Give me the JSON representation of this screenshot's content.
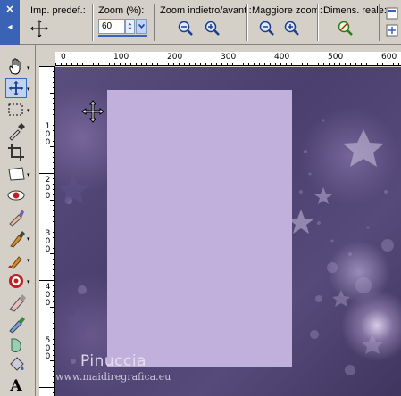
{
  "toolbar": {
    "presets_label": "Imp. predef.:",
    "zoom_label": "Zoom (%):",
    "zoom_value": "60",
    "zoom_inout_label": "Zoom indietro/avanti:",
    "zoom_more_label": "Maggiore zoom:",
    "actual_size_label": "Dimens. reale:"
  },
  "ruler_top": [
    "0",
    "100",
    "200",
    "300",
    "400",
    "500",
    "600"
  ],
  "ruler_left": [
    "1 0 0",
    "2 0 0",
    "3 0 0",
    "4 0 0",
    "5 0 0"
  ],
  "tools": [
    "pan-tool-icon",
    "move-tool-icon",
    "selection-tool-icon",
    "eyedropper-tool-icon",
    "crop-tool-icon",
    "deform-tool-icon",
    "red-eye-tool-icon",
    "makeover-tool-icon",
    "clone-brush-icon",
    "paint-brush-icon",
    "lighten-darken-icon",
    "eraser-tool-icon",
    "color-replacer-icon",
    "retouch-tool-icon",
    "bucket-fill-icon",
    "text-tool-icon"
  ],
  "canvas": {
    "watermark": "Pinuccia",
    "watermark_url": "www.maidiregrafica.eu"
  },
  "colors": {
    "selection_fill": "#c2b0dc",
    "background_dark": "#4a3f6e",
    "toolbar_grip": "#3a62b5"
  }
}
